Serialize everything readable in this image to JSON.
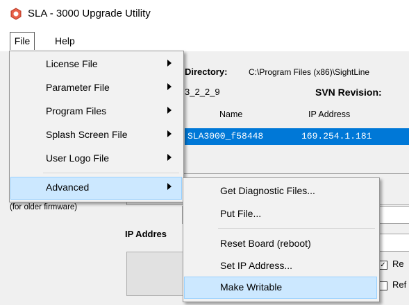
{
  "window": {
    "title": "SLA - 3000 Upgrade Utility"
  },
  "menubar": {
    "file": "File",
    "help": "Help"
  },
  "main": {
    "directory_label": "Directory:",
    "directory_value": "C:\\Program Files (x86)\\SightLine",
    "version_partial": "3_2_2_9",
    "svn_label": "SVN Revision:",
    "columns": {
      "name": "Name",
      "ip": "IP Address"
    },
    "row": {
      "name": "SLA3000_f58448",
      "ip": "169.254.1.181"
    },
    "older_fw_note": "(for older firmware)",
    "ip_label_partial": "IP Addres",
    "checkbox1_partial": "Re",
    "checkbox2_partial": "Ref"
  },
  "file_menu": {
    "items": [
      {
        "label": "License File",
        "submenu": true
      },
      {
        "label": "Parameter File",
        "submenu": true
      },
      {
        "label": "Program Files",
        "submenu": true
      },
      {
        "label": "Splash Screen File",
        "submenu": true
      },
      {
        "label": "User Logo File",
        "submenu": true
      },
      {
        "label": "Advanced",
        "submenu": true,
        "highlighted": true
      }
    ]
  },
  "advanced_menu": {
    "items": [
      {
        "label": "Get Diagnostic Files..."
      },
      {
        "label": "Put File..."
      },
      {
        "label": "Reset Board (reboot)"
      },
      {
        "label": "Set IP Address..."
      },
      {
        "label": "Make Writable",
        "highlighted": true
      }
    ]
  },
  "colors": {
    "selection": "#0078d7",
    "menu_highlight": "#cce8ff",
    "menu_highlight_border": "#99d1ff"
  }
}
